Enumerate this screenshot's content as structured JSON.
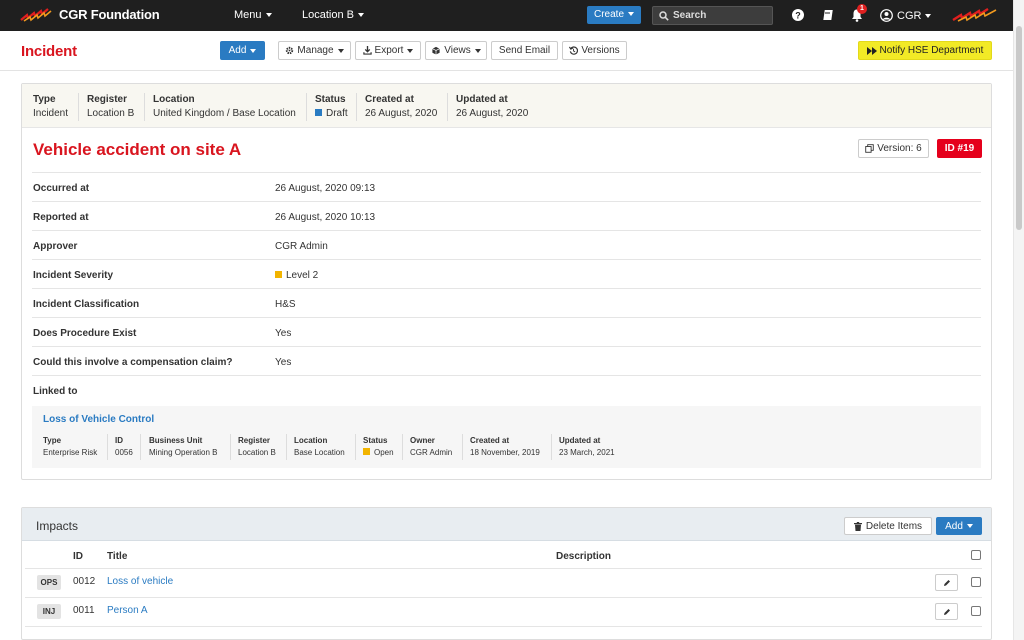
{
  "nav": {
    "brand": "CGR Foundation",
    "menu": "Menu",
    "location": "Location B",
    "create": "Create",
    "search_placeholder": "Search",
    "notification_count": "1",
    "user": "CGR"
  },
  "toolbar": {
    "page_title": "Incident",
    "add": "Add",
    "manage": "Manage",
    "export": "Export",
    "views": "Views",
    "send_email": "Send Email",
    "versions": "Versions",
    "notify": "Notify HSE Department"
  },
  "meta": {
    "type_label": "Type",
    "type": "Incident",
    "register_label": "Register",
    "register": "Location B",
    "location_label": "Location",
    "location": "United Kingdom / Base Location",
    "status_label": "Status",
    "status": "Draft",
    "status_color": "#2a7bc2",
    "created_label": "Created at",
    "created": "26 August, 2020",
    "updated_label": "Updated at",
    "updated": "26 August, 2020"
  },
  "record": {
    "title": "Vehicle accident on site A",
    "version": "Version: 6",
    "id": "ID #19"
  },
  "fields": [
    {
      "label": "Occurred at",
      "value": "26 August, 2020 09:13"
    },
    {
      "label": "Reported at",
      "value": "26 August, 2020 10:13"
    },
    {
      "label": "Approver",
      "value": "CGR Admin"
    },
    {
      "label": "Incident Severity",
      "value": "Level 2",
      "color": "#f2b400"
    },
    {
      "label": "Incident Classification",
      "value": "H&S"
    },
    {
      "label": "Does Procedure Exist",
      "value": "Yes"
    },
    {
      "label": "Could this involve a compensation claim?",
      "value": "Yes"
    },
    {
      "label": "Linked to",
      "value": ""
    }
  ],
  "linked": {
    "title": "Loss of Vehicle Control",
    "type_label": "Type",
    "type": "Enterprise Risk",
    "id_label": "ID",
    "id": "0056",
    "bu_label": "Business Unit",
    "bu": "Mining Operation B",
    "register_label": "Register",
    "register": "Location B",
    "location_label": "Location",
    "location": "Base Location",
    "status_label": "Status",
    "status": "Open",
    "status_color": "#f2b400",
    "owner_label": "Owner",
    "owner": "CGR Admin",
    "created_label": "Created at",
    "created": "18 November, 2019",
    "updated_label": "Updated at",
    "updated": "23 March, 2021"
  },
  "impacts": {
    "title": "Impacts",
    "delete_items": "Delete Items",
    "add": "Add",
    "col_id": "ID",
    "col_title": "Title",
    "col_description": "Description",
    "rows": [
      {
        "category": "OPS",
        "id": "0012",
        "title": "Loss of vehicle"
      },
      {
        "category": "INJ",
        "id": "0011",
        "title": "Person A"
      }
    ]
  }
}
